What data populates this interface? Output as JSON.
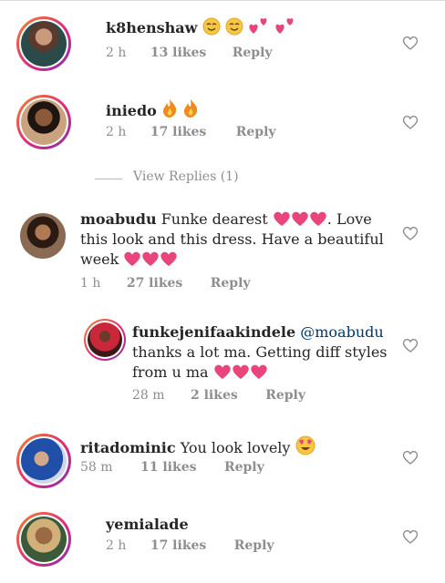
{
  "comments": [
    {
      "username": "k8henshaw",
      "text": "",
      "emoji": [
        "smiling-face-icon",
        "smiling-face-icon",
        "two-hearts-icon",
        "two-hearts-icon"
      ],
      "time": "2 h",
      "likes": "13 likes",
      "reply": "Reply"
    },
    {
      "username": "iniedo",
      "text": "",
      "emoji": [
        "fire-icon",
        "fire-icon"
      ],
      "time": "2 h",
      "likes": "17 likes",
      "reply": "Reply"
    },
    {
      "username": "moabudu",
      "text_1": "Funke dearest",
      "text_2": ". Love",
      "text_3": "this look and this dress. Have a beautiful",
      "text_4": "week",
      "emoji": [
        "heart-icon"
      ],
      "time": "1 h",
      "likes": "27 likes",
      "reply": "Reply"
    },
    {
      "username": "funkejenifaakindele",
      "mention": "@moabudu",
      "text_1": "thanks a lot ma. Getting diff styles",
      "text_2": "from u ma",
      "emoji": [
        "heart-icon"
      ],
      "time": "28 m",
      "likes": "2 likes",
      "reply": "Reply"
    },
    {
      "username": "ritadominic",
      "text": "You look lovely",
      "emoji": [
        "heart-eyes-icon"
      ],
      "time": "58 m",
      "likes": "11 likes",
      "reply": "Reply"
    },
    {
      "username": "yemialade",
      "text": "",
      "emoji": [],
      "time": "2 h",
      "likes": "17 likes",
      "reply": "Reply"
    }
  ],
  "view_replies": "View Replies (1)",
  "colors": {
    "heart": "#e8457a",
    "meta": "#8e8e8e",
    "text": "#262626",
    "ring_start": "#f58529",
    "ring_mid": "#dd2a7b",
    "ring_end": "#8134af"
  }
}
